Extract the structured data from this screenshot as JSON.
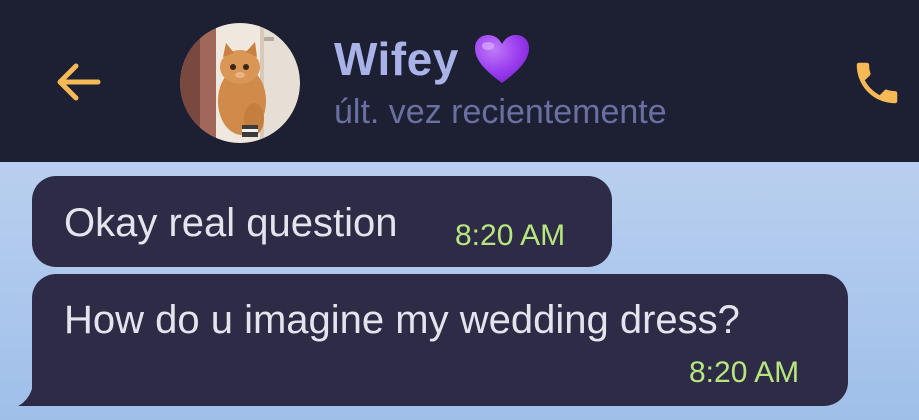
{
  "header": {
    "contact_name": "Wifey",
    "status": "últ. vez recientemente",
    "back_icon": "arrow-left-icon",
    "call_icon": "phone-icon",
    "heart_icon": "purple-heart-icon",
    "avatar_icon": "cat-avatar"
  },
  "messages": [
    {
      "text": "Okay real question",
      "time": "8:20 AM"
    },
    {
      "text": "How do u imagine my wedding dress?",
      "time": "8:20 AM"
    }
  ],
  "colors": {
    "header_bg": "#1d1f33",
    "accent": "#f7b955",
    "name": "#aab3e8",
    "status": "#6a70a2",
    "bubble_bg": "#2d2b46",
    "time": "#b7e67e",
    "heart": "#9b3ff0",
    "chat_bg": "#b9cfef"
  }
}
